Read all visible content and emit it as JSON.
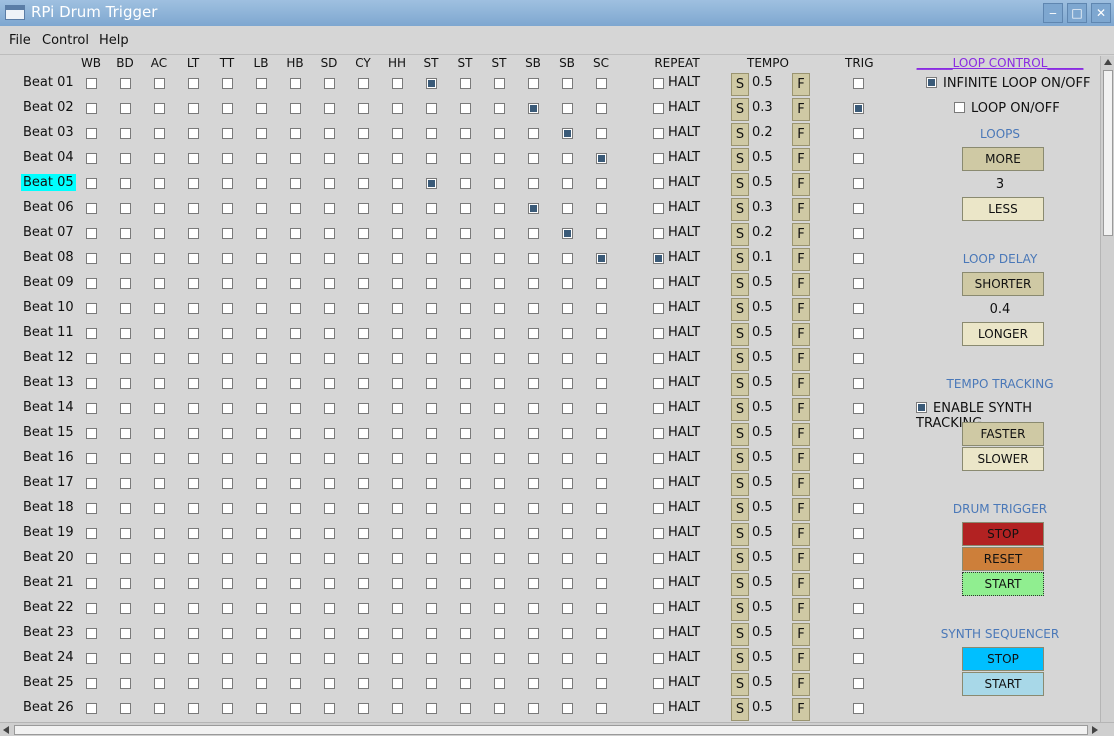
{
  "window": {
    "title": "RPi Drum Trigger",
    "minimize": "‒",
    "maximize": "□",
    "close": "✕"
  },
  "menu": [
    "File",
    "Control",
    "Help"
  ],
  "headers": {
    "drums": [
      "WB",
      "BD",
      "AC",
      "LT",
      "TT",
      "LB",
      "HB",
      "SD",
      "CY",
      "HH",
      "ST",
      "ST",
      "ST",
      "SB",
      "SB",
      "SC"
    ],
    "repeat": "REPEAT",
    "tempo": "TEMPO",
    "trig": "TRIG"
  },
  "common": {
    "halt": "HALT",
    "slower": "S",
    "faster": "F"
  },
  "rows": [
    {
      "label": "Beat 01",
      "checked": [
        10
      ],
      "repeat": false,
      "tempo": "0.5",
      "trig": false,
      "highlight": false
    },
    {
      "label": "Beat 02",
      "checked": [
        13
      ],
      "repeat": false,
      "tempo": "0.3",
      "trig": true,
      "highlight": false
    },
    {
      "label": "Beat 03",
      "checked": [
        14
      ],
      "repeat": false,
      "tempo": "0.2",
      "trig": false,
      "highlight": false
    },
    {
      "label": "Beat 04",
      "checked": [
        15
      ],
      "repeat": false,
      "tempo": "0.5",
      "trig": false,
      "highlight": false
    },
    {
      "label": "Beat 05",
      "checked": [
        10
      ],
      "repeat": false,
      "tempo": "0.5",
      "trig": false,
      "highlight": true
    },
    {
      "label": "Beat 06",
      "checked": [
        13
      ],
      "repeat": false,
      "tempo": "0.3",
      "trig": false,
      "highlight": false
    },
    {
      "label": "Beat 07",
      "checked": [
        14
      ],
      "repeat": false,
      "tempo": "0.2",
      "trig": false,
      "highlight": false
    },
    {
      "label": "Beat 08",
      "checked": [
        15
      ],
      "repeat": true,
      "tempo": "0.1",
      "trig": false,
      "highlight": false
    },
    {
      "label": "Beat 09",
      "checked": [],
      "repeat": false,
      "tempo": "0.5",
      "trig": false,
      "highlight": false
    },
    {
      "label": "Beat 10",
      "checked": [],
      "repeat": false,
      "tempo": "0.5",
      "trig": false,
      "highlight": false
    },
    {
      "label": "Beat 11",
      "checked": [],
      "repeat": false,
      "tempo": "0.5",
      "trig": false,
      "highlight": false
    },
    {
      "label": "Beat 12",
      "checked": [],
      "repeat": false,
      "tempo": "0.5",
      "trig": false,
      "highlight": false
    },
    {
      "label": "Beat 13",
      "checked": [],
      "repeat": false,
      "tempo": "0.5",
      "trig": false,
      "highlight": false
    },
    {
      "label": "Beat 14",
      "checked": [],
      "repeat": false,
      "tempo": "0.5",
      "trig": false,
      "highlight": false
    },
    {
      "label": "Beat 15",
      "checked": [],
      "repeat": false,
      "tempo": "0.5",
      "trig": false,
      "highlight": false
    },
    {
      "label": "Beat 16",
      "checked": [],
      "repeat": false,
      "tempo": "0.5",
      "trig": false,
      "highlight": false
    },
    {
      "label": "Beat 17",
      "checked": [],
      "repeat": false,
      "tempo": "0.5",
      "trig": false,
      "highlight": false
    },
    {
      "label": "Beat 18",
      "checked": [],
      "repeat": false,
      "tempo": "0.5",
      "trig": false,
      "highlight": false
    },
    {
      "label": "Beat 19",
      "checked": [],
      "repeat": false,
      "tempo": "0.5",
      "trig": false,
      "highlight": false
    },
    {
      "label": "Beat 20",
      "checked": [],
      "repeat": false,
      "tempo": "0.5",
      "trig": false,
      "highlight": false
    },
    {
      "label": "Beat 21",
      "checked": [],
      "repeat": false,
      "tempo": "0.5",
      "trig": false,
      "highlight": false
    },
    {
      "label": "Beat 22",
      "checked": [],
      "repeat": false,
      "tempo": "0.5",
      "trig": false,
      "highlight": false
    },
    {
      "label": "Beat 23",
      "checked": [],
      "repeat": false,
      "tempo": "0.5",
      "trig": false,
      "highlight": false
    },
    {
      "label": "Beat 24",
      "checked": [],
      "repeat": false,
      "tempo": "0.5",
      "trig": false,
      "highlight": false
    },
    {
      "label": "Beat 25",
      "checked": [],
      "repeat": false,
      "tempo": "0.5",
      "trig": false,
      "highlight": false
    },
    {
      "label": "Beat 26",
      "checked": [],
      "repeat": false,
      "tempo": "0.5",
      "trig": false,
      "highlight": false
    }
  ],
  "panel": {
    "loop_control": {
      "title": "______LOOP CONTROL______",
      "infinite_label": "INFINITE LOOP ON/OFF",
      "infinite_on": true,
      "loop_label": "LOOP ON/OFF",
      "loop_on": false
    },
    "loops": {
      "title": "LOOPS",
      "more": "MORE",
      "value": "3",
      "less": "LESS"
    },
    "loop_delay": {
      "title": "LOOP DELAY",
      "shorter": "SHORTER",
      "value": "0.4",
      "longer": "LONGER"
    },
    "tempo_tracking": {
      "title": "TEMPO TRACKING",
      "synth_label": "ENABLE SYNTH TRACKING",
      "synth_on": true,
      "faster": "FASTER",
      "slower": "SLOWER"
    },
    "drum_trigger": {
      "title": "DRUM TRIGGER",
      "stop": "STOP",
      "reset": "RESET",
      "start": "START"
    },
    "synth_sequencer": {
      "title": "SYNTH SEQUENCER",
      "stop": "STOP",
      "start": "START"
    }
  },
  "colors": {
    "accent_title": "#4a78b8",
    "loop_control_title": "#8a2be2",
    "highlight": "#00ffff",
    "button_khaki": "#cfc9a4",
    "button_light": "#ebe6c8",
    "drum_stop": "#b22222",
    "drum_reset": "#cd7f3a",
    "drum_start": "#90ee90",
    "synth_stop": "#00bfff",
    "synth_start": "#a8d8e8"
  }
}
